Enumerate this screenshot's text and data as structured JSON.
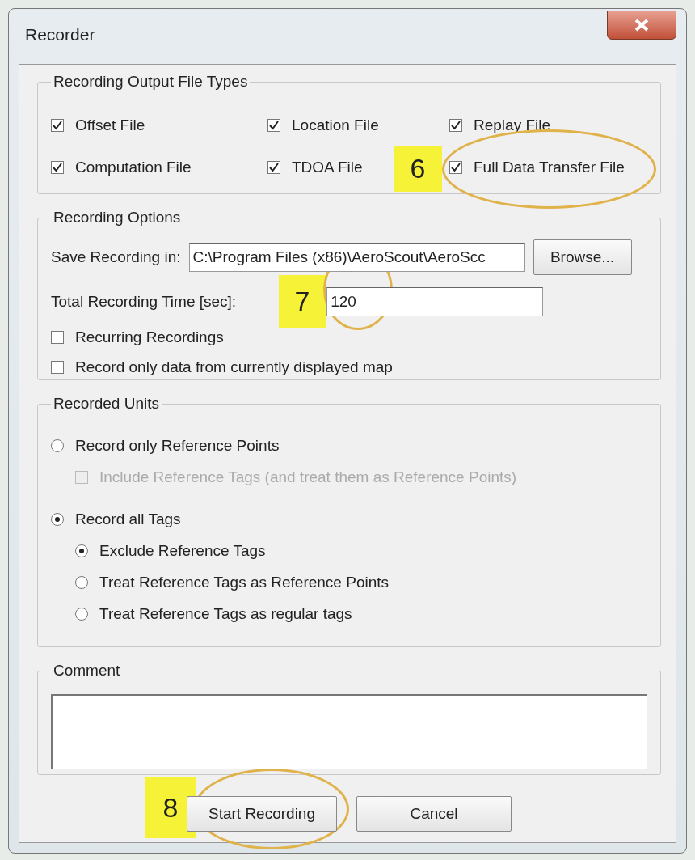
{
  "window": {
    "title": "Recorder"
  },
  "output_file_types": {
    "title": "Recording Output File Types",
    "files": [
      {
        "label": "Offset File",
        "checked": true
      },
      {
        "label": "Location File",
        "checked": true
      },
      {
        "label": "Replay File",
        "checked": true
      },
      {
        "label": "Computation File",
        "checked": true
      },
      {
        "label": "TDOA File",
        "checked": true
      },
      {
        "label": "Full Data Transfer File",
        "checked": true
      }
    ]
  },
  "recording_options": {
    "title": "Recording Options",
    "save_in": {
      "label": "Save Recording in:",
      "value": "C:\\Program Files (x86)\\AeroScout\\AeroScc",
      "button": "Browse..."
    },
    "total_time": {
      "label": "Total Recording Time [sec]:",
      "value": "120"
    },
    "checks": [
      {
        "label": "Recurring Recordings",
        "checked": false
      },
      {
        "label": "Record only data from currently displayed map",
        "checked": false
      }
    ]
  },
  "recorded_units": {
    "title": "Recorded Units",
    "options": [
      {
        "kind": "radio",
        "label": "Record only Reference Points",
        "selected": false,
        "children": [
          {
            "kind": "checkbox",
            "label": "Include Reference Tags (and treat them as Reference Points)",
            "checked": false,
            "disabled": true
          }
        ]
      },
      {
        "kind": "radio",
        "label": "Record all Tags",
        "selected": true,
        "children": [
          {
            "kind": "radio",
            "label": "Exclude Reference Tags",
            "selected": true
          },
          {
            "kind": "radio",
            "label": "Treat Reference Tags as Reference Points",
            "selected": false
          },
          {
            "kind": "radio",
            "label": "Treat Reference Tags as regular tags",
            "selected": false
          }
        ]
      }
    ]
  },
  "comment": {
    "title": "Comment"
  },
  "buttons": [
    "Start Recording",
    "Cancel"
  ],
  "callouts": [
    {
      "label": "6"
    },
    {
      "label": "7"
    },
    {
      "label": "8"
    }
  ]
}
